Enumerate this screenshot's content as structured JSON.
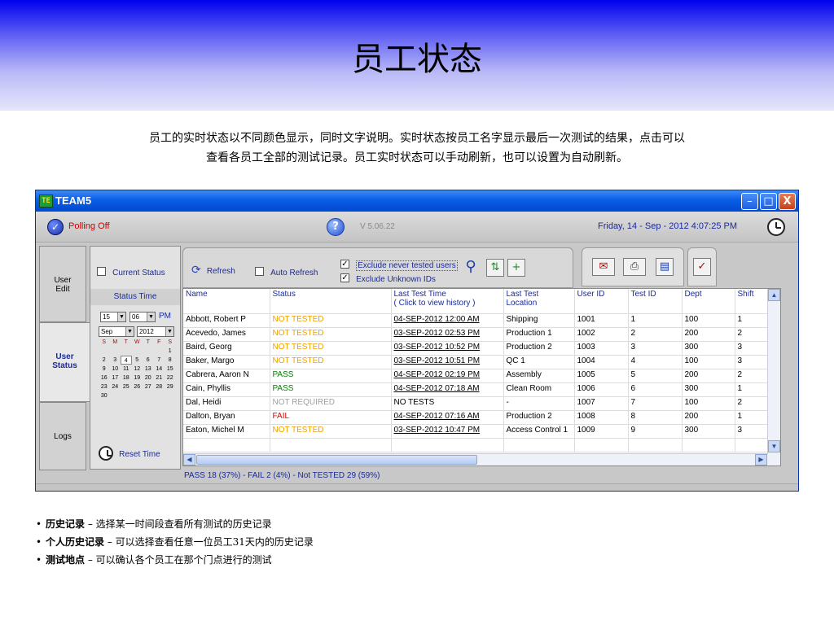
{
  "slide": {
    "title": "员工状态",
    "intro_line1": "员工的实时状态以不同颜色显示，同时文字说明。实时状态按员工名字显示最后一次测试的结果，点击可以",
    "intro_line2": "查看各员工全部的测试记录。员工实时状态可以手动刷新，也可以设置为自动刷新。"
  },
  "window": {
    "logo_text": "TE",
    "title": "TEAM5",
    "buttons": {
      "minimize": "–",
      "maximize": "□",
      "close": "X"
    }
  },
  "topbar": {
    "polling_label": "Polling Off",
    "version": "V 5.06.22",
    "datetime": "Friday, 14 - Sep - 2012   4:07:25 PM"
  },
  "tabs": [
    {
      "label": "User\nEdit"
    },
    {
      "label": "User\nStatus"
    },
    {
      "label": "Logs"
    }
  ],
  "sidepanel": {
    "current_status_label": "Current Status",
    "current_status_checked": false,
    "status_time_label": "Status Time",
    "hour": "15",
    "minute": "06",
    "ampm": "PM",
    "month": "Sep",
    "year": "2012",
    "weekday_headers": [
      "S",
      "M",
      "T",
      "W",
      "T",
      "F",
      "S"
    ],
    "calendar_rows": [
      [
        "",
        "",
        "",
        "",
        "",
        "",
        "1"
      ],
      [
        "2",
        "3",
        "4",
        "5",
        "6",
        "7",
        "8"
      ],
      [
        "9",
        "10",
        "11",
        "12",
        "13",
        "14",
        "15"
      ],
      [
        "16",
        "17",
        "18",
        "19",
        "20",
        "21",
        "22"
      ],
      [
        "23",
        "24",
        "25",
        "26",
        "27",
        "28",
        "29"
      ],
      [
        "30",
        "",
        "",
        "",
        "",
        "",
        ""
      ]
    ],
    "selected_day": "4",
    "reset_time_label": "Reset Time"
  },
  "toolbar": {
    "refresh_label": "Refresh",
    "auto_refresh_label": "Auto Refresh",
    "auto_refresh_checked": false,
    "exclude_never_tested_label": "Exclude never tested users",
    "exclude_never_tested_checked": true,
    "exclude_unknown_ids_label": "Exclude Unknown IDs",
    "exclude_unknown_ids_checked": true
  },
  "grid": {
    "columns": [
      "Name",
      "Status",
      "Last Test Time\n( Click to view history )",
      "Last Test\nLocation",
      "User ID",
      "Test ID",
      "Dept",
      "Shift"
    ],
    "status_colors": {
      "PASS": "#008000",
      "FAIL": "#e00000",
      "NOT TESTED": "#f0a000",
      "NOT REQUIRED": "#a0a0a0"
    },
    "rows": [
      [
        "Abbott, Robert P",
        "NOT TESTED",
        "04-SEP-2012 12:00 AM",
        "Shipping",
        "1001",
        "1",
        "100",
        "1"
      ],
      [
        "Acevedo, James",
        "NOT TESTED",
        "03-SEP-2012 02:53 PM",
        "Production 1",
        "1002",
        "2",
        "200",
        "2"
      ],
      [
        "Baird, Georg",
        "NOT TESTED",
        "03-SEP-2012 10:52 PM",
        "Production 2",
        "1003",
        "3",
        "300",
        "3"
      ],
      [
        "Baker, Margo",
        "NOT TESTED",
        "03-SEP-2012 10:51 PM",
        "QC 1",
        "1004",
        "4",
        "100",
        "3"
      ],
      [
        "Cabrera, Aaron N",
        "PASS",
        "04-SEP-2012 02:19 PM",
        "Assembly",
        "1005",
        "5",
        "200",
        "2"
      ],
      [
        "Cain, Phyllis",
        "PASS",
        "04-SEP-2012 07:18 AM",
        "Clean Room",
        "1006",
        "6",
        "300",
        "1"
      ],
      [
        "Dal, Heidi",
        "NOT REQUIRED",
        "NO TESTS",
        "-",
        "1007",
        "7",
        "100",
        "2"
      ],
      [
        "Dalton, Bryan",
        "FAIL",
        "04-SEP-2012 07:16 AM",
        "Production 2",
        "1008",
        "8",
        "200",
        "1"
      ],
      [
        "Eaton, Michel M",
        "NOT TESTED",
        "03-SEP-2012 10:47 PM",
        "Access Control 1",
        "1009",
        "9",
        "300",
        "3"
      ]
    ],
    "summary": "PASS 18 (37%)  -  FAIL 2 (4%)  -  Not TESTED 29 (59%)"
  },
  "bullets": [
    {
      "term": "历史记录",
      "sep": " – ",
      "text": " 选择某一时间段查看所有测试的历史记录"
    },
    {
      "term": "个人历史记录",
      "sep": " – ",
      "text": "可以选择查看任意一位员工31天内的历史记录"
    },
    {
      "term": "测试地点",
      "sep": " – ",
      "text": "可以确认各个员工在那个门点进行的测试"
    }
  ]
}
